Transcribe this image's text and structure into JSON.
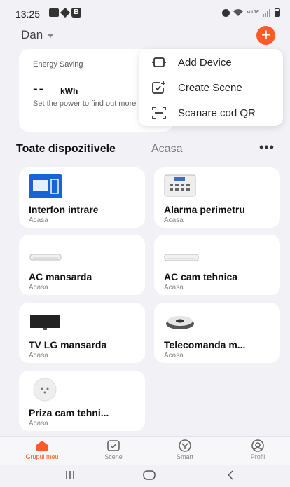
{
  "status_bar": {
    "time": "13:25",
    "b_badge": "B",
    "net": "VoLTE"
  },
  "header": {
    "home_name": "Dan",
    "add_symbol": "+"
  },
  "energy": {
    "title": "Energy Saving",
    "value": "--",
    "unit": "kWh",
    "hint": "Set the power to find out more"
  },
  "menu": {
    "items": [
      {
        "label": "Add Device",
        "icon": "add-device-icon"
      },
      {
        "label": "Create Scene",
        "icon": "create-scene-icon"
      },
      {
        "label": "Scanare cod QR",
        "icon": "qr-scan-icon"
      }
    ]
  },
  "section": {
    "title": "Toate dispozitivele",
    "room_tab": "Acasa",
    "more": "•••"
  },
  "devices": [
    {
      "name": "Interfon intrare",
      "room": "Acasa",
      "icon": "intercom-icon"
    },
    {
      "name": "Alarma perimetru",
      "room": "Acasa",
      "icon": "alarm-panel-icon"
    },
    {
      "name": "AC mansarda",
      "room": "Acasa",
      "icon": "air-conditioner-icon"
    },
    {
      "name": "AC cam tehnica",
      "room": "Acasa",
      "icon": "air-conditioner-icon"
    },
    {
      "name": "TV LG mansarda",
      "room": "Acasa",
      "icon": "tv-icon"
    },
    {
      "name": "Telecomanda m...",
      "room": "Acasa",
      "icon": "ir-remote-icon"
    },
    {
      "name": "Priza cam tehni...",
      "room": "Acasa",
      "icon": "smart-plug-icon"
    }
  ],
  "tabs": [
    {
      "label": "Grupul meu",
      "icon": "home-icon",
      "active": true
    },
    {
      "label": "Scene",
      "icon": "scene-icon",
      "active": false
    },
    {
      "label": "Smart",
      "icon": "smart-icon",
      "active": false
    },
    {
      "label": "Profil",
      "icon": "profile-icon",
      "active": false
    }
  ],
  "colors": {
    "accent": "#ff5a2a",
    "background": "#f2f2f6",
    "card": "#ffffff"
  }
}
